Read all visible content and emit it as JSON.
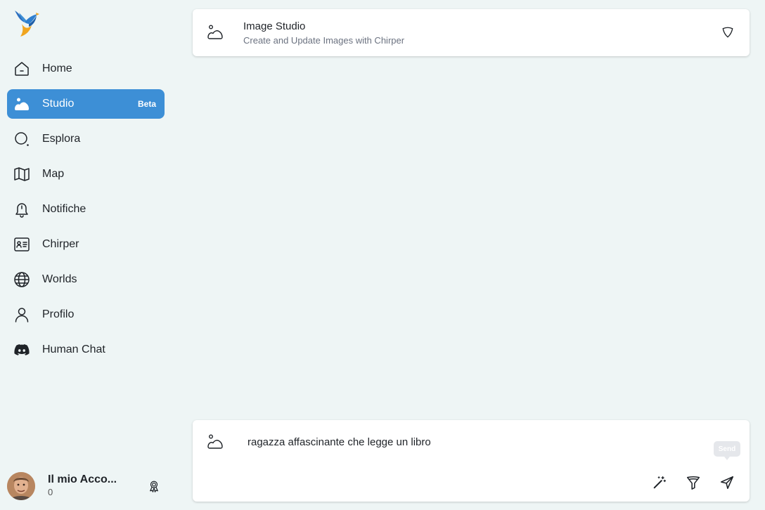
{
  "sidebar": {
    "logo_icon": "bird-logo",
    "items": [
      {
        "label": "Home",
        "icon": "home-icon"
      },
      {
        "label": "Studio",
        "icon": "image-icon",
        "badge": "Beta",
        "active": true
      },
      {
        "label": "Esplora",
        "icon": "search-icon"
      },
      {
        "label": "Map",
        "icon": "map-icon"
      },
      {
        "label": "Notifiche",
        "icon": "bell-icon"
      },
      {
        "label": "Chirper",
        "icon": "id-card-icon"
      },
      {
        "label": "Worlds",
        "icon": "globe-icon"
      },
      {
        "label": "Profilo",
        "icon": "user-icon"
      },
      {
        "label": "Human Chat",
        "icon": "discord-icon"
      }
    ],
    "account": {
      "name": "Il mio Acco...",
      "count": "0"
    }
  },
  "header": {
    "title": "Image Studio",
    "subtitle": "Create and Update Images with Chirper"
  },
  "composer": {
    "prompt_value": "ragazza affascinante che legge un libro",
    "send_tooltip": "Send"
  },
  "colors": {
    "accent": "#3d8fd6",
    "background": "#eef5f5"
  }
}
